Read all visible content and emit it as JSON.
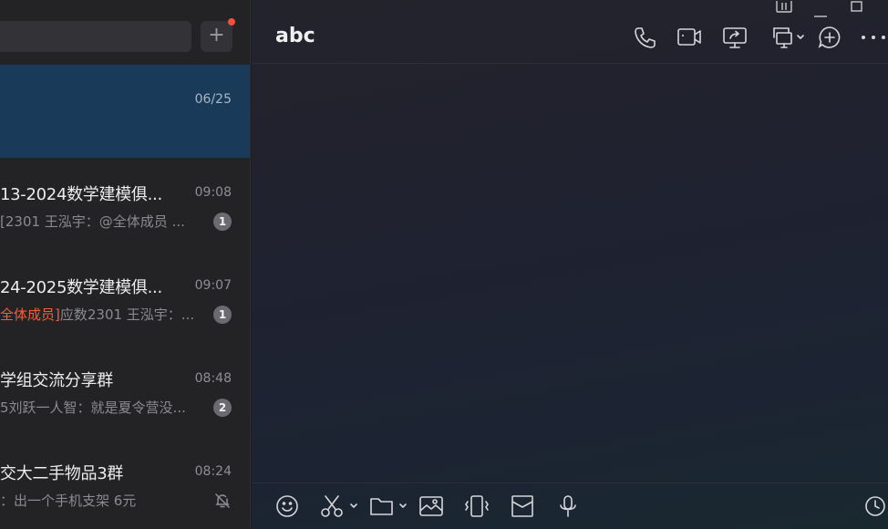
{
  "sidebar": {
    "add_label": "+",
    "chats": [
      {
        "name": "",
        "time": "06/25",
        "preview": "",
        "badge": "",
        "selected": true
      },
      {
        "name": "13-2024数学建模俱...",
        "time": "09:08",
        "preview_prefix": "",
        "preview": "[2301 王泓宇：@全体成员 ...",
        "badge": "1"
      },
      {
        "name": "24-2025数学建模俱...",
        "time": "09:07",
        "preview_prefix": "全体成员]",
        "preview": "应数2301 王泓宇：...",
        "badge": "1"
      },
      {
        "name": "学组交流分享群",
        "time": "08:48",
        "preview_prefix": "",
        "preview": "5刘跃一人智：就是夏令营没...",
        "badge": "2"
      },
      {
        "name": "交大二手物品3群",
        "time": "08:24",
        "preview_prefix": "",
        "preview": "：出一个手机支架 6元",
        "badge": "",
        "muted": true
      }
    ]
  },
  "chat": {
    "title": "abc"
  },
  "header_icons": [
    "phone-icon",
    "video-call-icon",
    "screen-share-icon",
    "screen-capture-icon",
    "add-circle-icon",
    "more-icon"
  ],
  "window_controls": [
    "pin-icon",
    "minimize-icon",
    "maximize-icon"
  ],
  "toolbar_icons": [
    "emoji-icon",
    "scissors-icon",
    "folder-icon",
    "image-icon",
    "shake-icon",
    "red-packet-icon",
    "microphone-icon",
    "history-icon"
  ],
  "colors": {
    "selected_bg": "#1a3a5a",
    "mention": "#f06040",
    "red_dot": "#f0503c"
  }
}
